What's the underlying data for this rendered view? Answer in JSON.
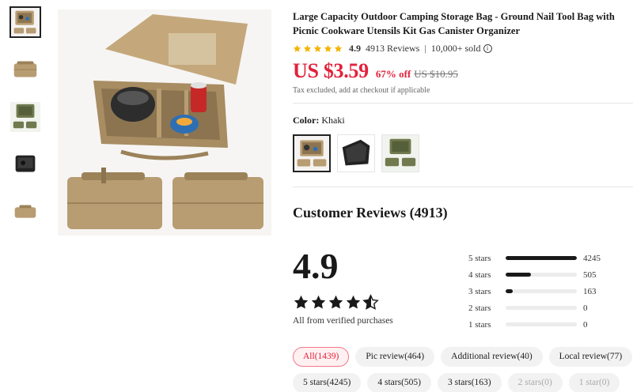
{
  "product": {
    "title": "Large Capacity Outdoor Camping Storage Bag - Ground Nail Tool Bag with Picnic Cookware Utensils Kit Gas Canister Organizer",
    "rating": "4.9",
    "reviews_text": "4913 Reviews",
    "separator": "|",
    "sold_text": "10,000+ sold",
    "price": "US $3.59",
    "discount": "67% off",
    "original_price": "US $10.95",
    "tax_note": "Tax excluded, add at checkout if applicable",
    "info_icon": "i"
  },
  "color": {
    "label": "Color: ",
    "selected": "Khaki",
    "options": [
      "khaki",
      "black",
      "green"
    ]
  },
  "colors": {
    "accent": "#e3213b",
    "khaki": "#b89c72",
    "star": "#f5b400"
  },
  "reviews": {
    "title": "Customer Reviews (4913)",
    "average": "4.9",
    "verified_note": "All from verified purchases",
    "distribution": [
      {
        "label": "5 stars",
        "count": "4245",
        "fraction": 1.0
      },
      {
        "label": "4 stars",
        "count": "505",
        "fraction": 0.36
      },
      {
        "label": "3 stars",
        "count": "163",
        "fraction": 0.1
      },
      {
        "label": "2 stars",
        "count": "0",
        "fraction": 0
      },
      {
        "label": "1 stars",
        "count": "0",
        "fraction": 0
      }
    ]
  },
  "filters": {
    "row1": [
      {
        "label": "All(1439)",
        "state": "active"
      },
      {
        "label": "Pic review(464)",
        "state": "normal"
      },
      {
        "label": "Additional review(40)",
        "state": "normal"
      },
      {
        "label": "Local review(77)",
        "state": "normal"
      }
    ],
    "row2": [
      {
        "label": "5 stars(4245)",
        "state": "normal"
      },
      {
        "label": "4 stars(505)",
        "state": "normal"
      },
      {
        "label": "3 stars(163)",
        "state": "normal"
      },
      {
        "label": "2 stars(0)",
        "state": "disabled"
      },
      {
        "label": "1 star(0)",
        "state": "disabled"
      }
    ]
  },
  "icons": {
    "star": "star-icon",
    "info": "info-icon"
  }
}
